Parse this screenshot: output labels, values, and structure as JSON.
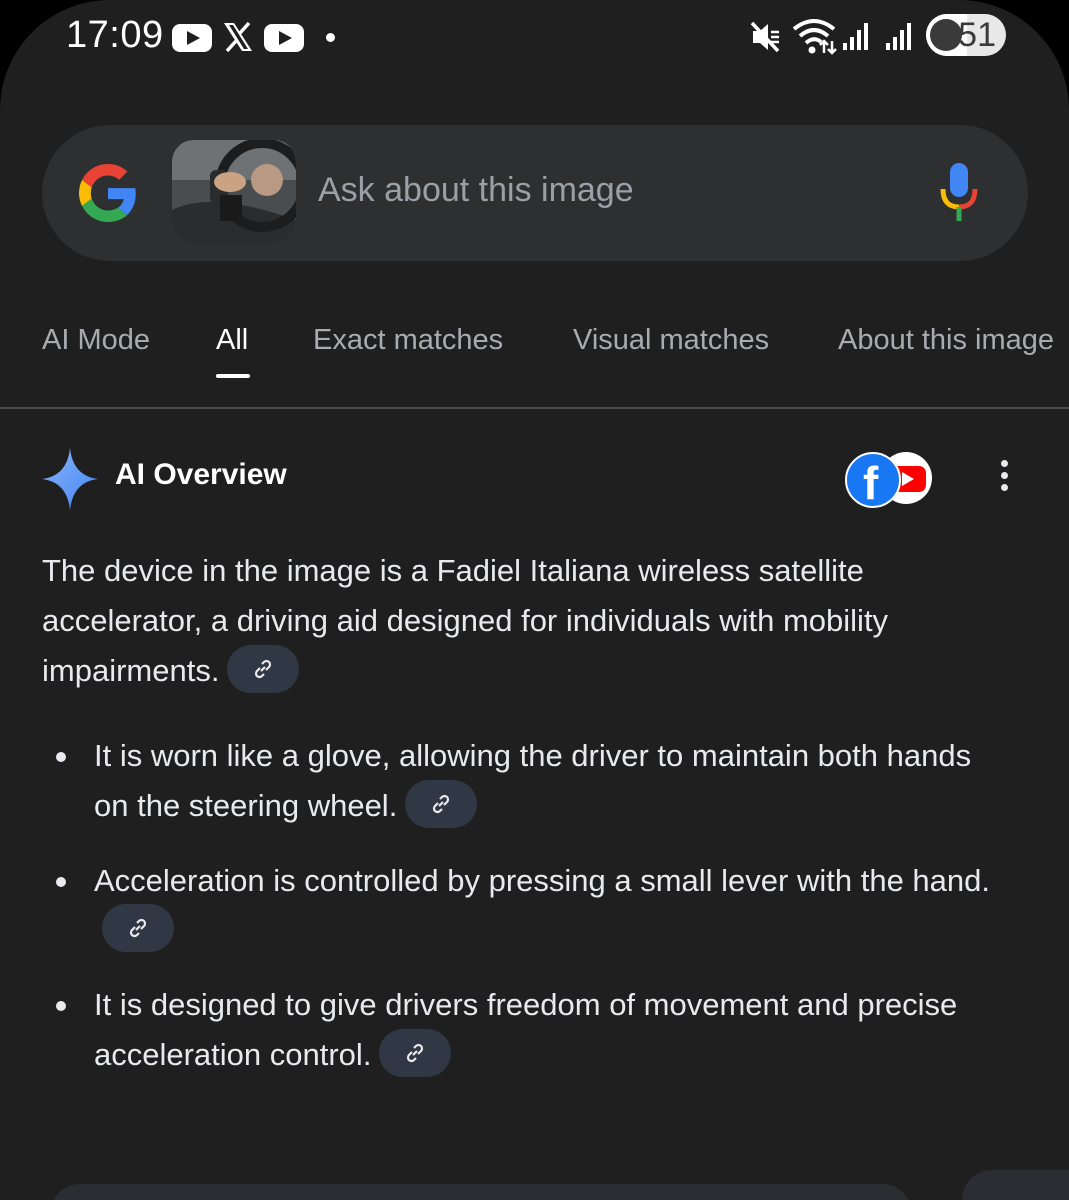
{
  "status_bar": {
    "time": "17:09",
    "battery_percent": "51",
    "battery_level": 0.51,
    "notification_icons": [
      "youtube-icon",
      "x-icon",
      "youtube-icon",
      "dot-icon"
    ],
    "system_icons": [
      "mute-icon",
      "wifi-icon",
      "signal-icon",
      "signal-icon"
    ]
  },
  "search": {
    "placeholder": "Ask about this image",
    "logo": "google-g-logo",
    "voice": "mic-icon"
  },
  "tabs": [
    {
      "label": "AI Mode",
      "active": false
    },
    {
      "label": "All",
      "active": true
    },
    {
      "label": "Exact matches",
      "active": false
    },
    {
      "label": "Visual matches",
      "active": false
    },
    {
      "label": "About this image",
      "active": false
    }
  ],
  "ai_overview": {
    "title": "AI Overview",
    "sources": [
      "facebook-icon",
      "youtube-icon"
    ],
    "summary": "The device in the image is a Fadiel Italiana wireless satellite accelerator, a driving aid designed for individuals with mobility impairments.",
    "bullets": [
      "It is worn like a glove, allowing the driver to maintain both hands on the steering wheel.",
      "Acceleration is controlled by pressing a small lever with the hand.",
      "It is designed to give drivers freedom of movement and precise acceleration control."
    ]
  },
  "colors": {
    "background": "#1f1f1f",
    "search_bar": "#2d2f31",
    "link_chip": "#303845",
    "text": "#e8eaed",
    "muted": "#9aa0a6"
  }
}
